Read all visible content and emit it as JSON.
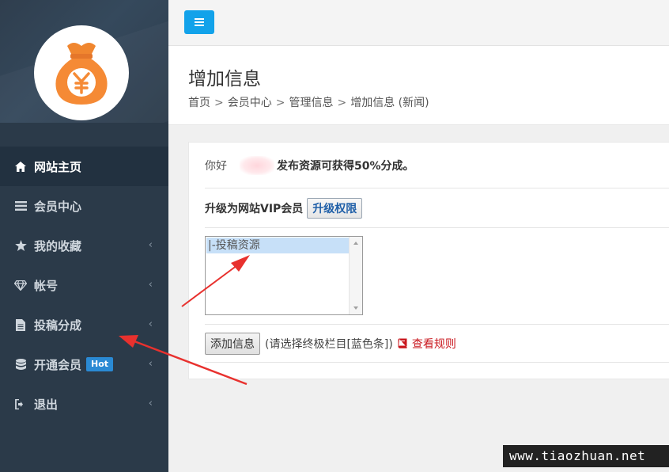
{
  "sidebar": {
    "items": [
      {
        "label": "网站主页",
        "icon": "home-icon",
        "active": true,
        "has_chevron": false
      },
      {
        "label": "会员中心",
        "icon": "list-icon",
        "active": false,
        "has_chevron": false
      },
      {
        "label": "我的收藏",
        "icon": "star-icon",
        "active": false,
        "has_chevron": true
      },
      {
        "label": "帐号",
        "icon": "diamond-icon",
        "active": false,
        "has_chevron": true
      },
      {
        "label": "投稿分成",
        "icon": "file-icon",
        "active": false,
        "has_chevron": true
      },
      {
        "label": "开通会员",
        "icon": "database-icon",
        "active": false,
        "has_chevron": true,
        "badge": "Hot"
      },
      {
        "label": "退出",
        "icon": "sign-out-icon",
        "active": false,
        "has_chevron": true
      }
    ],
    "chevron": "‹"
  },
  "header": {
    "title": "增加信息",
    "breadcrumb": [
      "首页",
      "会员中心",
      "管理信息",
      "增加信息 (新闻)"
    ],
    "breadcrumb_sep": ">"
  },
  "form": {
    "greeting": "你好",
    "greeting_suffix": "发布资源可获得50%分成。",
    "upgrade_text": "升级为网站VIP会员",
    "upgrade_button": "升级权限",
    "category_option": "|-投稿资源",
    "add_button": "添加信息",
    "hint": "(请选择终极栏目[蓝色条])",
    "rules_link": "查看规则"
  },
  "watermark": "www.tiaozhuan.net",
  "colors": {
    "sidebar_bg": "#2b3a49",
    "toggle_btn": "#12a2ea",
    "badge": "#2a8ad4",
    "link_red": "#c9171e",
    "arrow_red": "#e8312e"
  }
}
